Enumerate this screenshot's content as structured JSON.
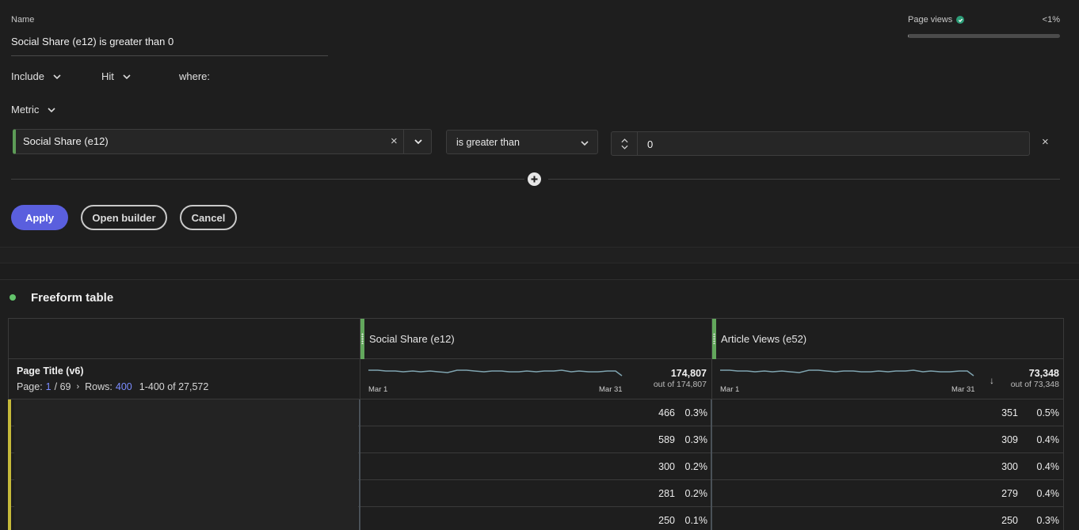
{
  "filter": {
    "name_label": "Name",
    "name_value": "Social Share (e12) is greater than 0",
    "include_label": "Include",
    "hit_label": "Hit",
    "where_label": "where:",
    "metric_label": "Metric",
    "metric_value": "Social Share (e12)",
    "operator_value": "is greater than",
    "number_value": "0",
    "page_views_label": "Page views",
    "page_views_pct": "<1%",
    "page_views_fraction": 0.005,
    "apply_label": "Apply",
    "open_builder_label": "Open builder",
    "cancel_label": "Cancel"
  },
  "freeform": {
    "title": "Freeform table",
    "dimension_title": "Page Title (v6)",
    "page_label": "Page:",
    "page_current": "1",
    "page_total": "/ 69",
    "rows_label": "Rows:",
    "rows_value": "400",
    "range_label": "1-400 of 27,572",
    "columns": [
      {
        "label": "Social Share (e12)",
        "total": "174,807",
        "out_of": "out of 174,807",
        "start_label": "Mar 1",
        "end_label": "Mar 31"
      },
      {
        "label": "Article Views (e52)",
        "total": "73,348",
        "out_of": "out of 73,348",
        "start_label": "Mar 1",
        "end_label": "Mar 31"
      }
    ],
    "rows": [
      {
        "v1": "466",
        "p1": "0.3%",
        "v2": "351",
        "p2": "0.5%"
      },
      {
        "v1": "589",
        "p1": "0.3%",
        "v2": "309",
        "p2": "0.4%"
      },
      {
        "v1": "300",
        "p1": "0.2%",
        "v2": "300",
        "p2": "0.4%"
      },
      {
        "v1": "281",
        "p1": "0.2%",
        "v2": "279",
        "p2": "0.4%"
      },
      {
        "v1": "250",
        "p1": "0.1%",
        "v2": "250",
        "p2": "0.3%"
      }
    ]
  },
  "colors": {
    "accent_button": "#5a5fde",
    "metric_bar": "#62a75c",
    "dimension_bar": "#c5b93a",
    "status_dot": "#63c46b"
  }
}
